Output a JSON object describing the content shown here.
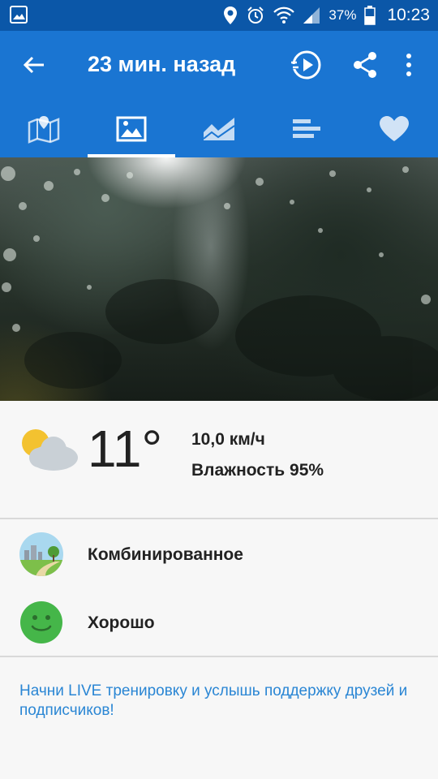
{
  "status_bar": {
    "battery_percent": "37%",
    "time": "10:23",
    "icons": [
      "gallery-icon",
      "location-icon",
      "alarm-icon",
      "wifi-icon",
      "signal-icon",
      "battery-icon"
    ]
  },
  "app_bar": {
    "title": "23 мин. назад",
    "actions": [
      "back-arrow-icon",
      "replay-icon",
      "share-icon",
      "more-vert-icon"
    ]
  },
  "tabs": [
    {
      "name": "map",
      "icon": "map-icon",
      "active": false
    },
    {
      "name": "photo",
      "icon": "image-icon",
      "active": true
    },
    {
      "name": "chart",
      "icon": "area-chart-icon",
      "active": false
    },
    {
      "name": "laps",
      "icon": "bars-icon",
      "active": false
    },
    {
      "name": "like",
      "icon": "heart-icon",
      "active": false
    }
  ],
  "weather": {
    "icon": "partly-cloudy-icon",
    "temperature": "11°",
    "wind": "10,0 км/ч",
    "humidity": "Влажность 95%"
  },
  "surface": {
    "icon": "landscape-icon",
    "label": "Комбинированное"
  },
  "mood": {
    "icon": "smiley-icon",
    "label": "Хорошо"
  },
  "cta": "Начни LIVE тренировку и услышь поддержку друзей и подписчиков!",
  "colors": {
    "status_bar": "#0b57a8",
    "app_bar": "#1a75d2",
    "accent_link": "#2a86d4",
    "mood_green": "#45b649"
  }
}
